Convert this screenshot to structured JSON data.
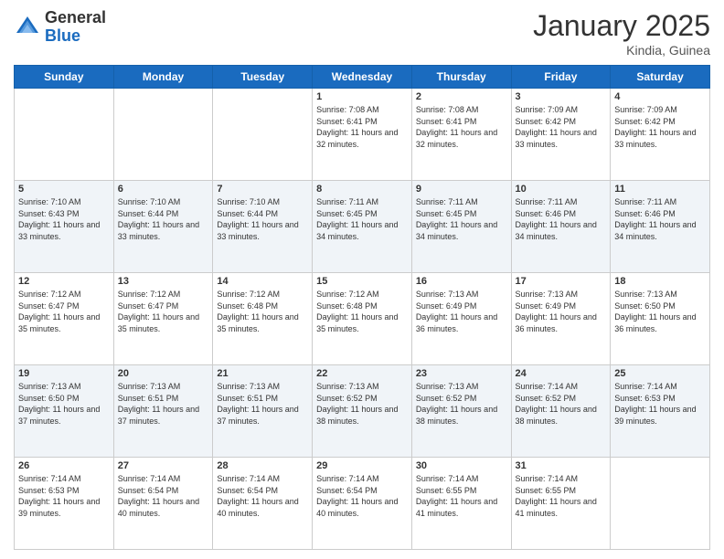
{
  "logo": {
    "general": "General",
    "blue": "Blue"
  },
  "header": {
    "month_year": "January 2025",
    "location": "Kindia, Guinea"
  },
  "weekdays": [
    "Sunday",
    "Monday",
    "Tuesday",
    "Wednesday",
    "Thursday",
    "Friday",
    "Saturday"
  ],
  "weeks": [
    [
      {
        "day": "",
        "sunrise": "",
        "sunset": "",
        "daylight": ""
      },
      {
        "day": "",
        "sunrise": "",
        "sunset": "",
        "daylight": ""
      },
      {
        "day": "",
        "sunrise": "",
        "sunset": "",
        "daylight": ""
      },
      {
        "day": "1",
        "sunrise": "Sunrise: 7:08 AM",
        "sunset": "Sunset: 6:41 PM",
        "daylight": "Daylight: 11 hours and 32 minutes."
      },
      {
        "day": "2",
        "sunrise": "Sunrise: 7:08 AM",
        "sunset": "Sunset: 6:41 PM",
        "daylight": "Daylight: 11 hours and 32 minutes."
      },
      {
        "day": "3",
        "sunrise": "Sunrise: 7:09 AM",
        "sunset": "Sunset: 6:42 PM",
        "daylight": "Daylight: 11 hours and 33 minutes."
      },
      {
        "day": "4",
        "sunrise": "Sunrise: 7:09 AM",
        "sunset": "Sunset: 6:42 PM",
        "daylight": "Daylight: 11 hours and 33 minutes."
      }
    ],
    [
      {
        "day": "5",
        "sunrise": "Sunrise: 7:10 AM",
        "sunset": "Sunset: 6:43 PM",
        "daylight": "Daylight: 11 hours and 33 minutes."
      },
      {
        "day": "6",
        "sunrise": "Sunrise: 7:10 AM",
        "sunset": "Sunset: 6:44 PM",
        "daylight": "Daylight: 11 hours and 33 minutes."
      },
      {
        "day": "7",
        "sunrise": "Sunrise: 7:10 AM",
        "sunset": "Sunset: 6:44 PM",
        "daylight": "Daylight: 11 hours and 33 minutes."
      },
      {
        "day": "8",
        "sunrise": "Sunrise: 7:11 AM",
        "sunset": "Sunset: 6:45 PM",
        "daylight": "Daylight: 11 hours and 34 minutes."
      },
      {
        "day": "9",
        "sunrise": "Sunrise: 7:11 AM",
        "sunset": "Sunset: 6:45 PM",
        "daylight": "Daylight: 11 hours and 34 minutes."
      },
      {
        "day": "10",
        "sunrise": "Sunrise: 7:11 AM",
        "sunset": "Sunset: 6:46 PM",
        "daylight": "Daylight: 11 hours and 34 minutes."
      },
      {
        "day": "11",
        "sunrise": "Sunrise: 7:11 AM",
        "sunset": "Sunset: 6:46 PM",
        "daylight": "Daylight: 11 hours and 34 minutes."
      }
    ],
    [
      {
        "day": "12",
        "sunrise": "Sunrise: 7:12 AM",
        "sunset": "Sunset: 6:47 PM",
        "daylight": "Daylight: 11 hours and 35 minutes."
      },
      {
        "day": "13",
        "sunrise": "Sunrise: 7:12 AM",
        "sunset": "Sunset: 6:47 PM",
        "daylight": "Daylight: 11 hours and 35 minutes."
      },
      {
        "day": "14",
        "sunrise": "Sunrise: 7:12 AM",
        "sunset": "Sunset: 6:48 PM",
        "daylight": "Daylight: 11 hours and 35 minutes."
      },
      {
        "day": "15",
        "sunrise": "Sunrise: 7:12 AM",
        "sunset": "Sunset: 6:48 PM",
        "daylight": "Daylight: 11 hours and 35 minutes."
      },
      {
        "day": "16",
        "sunrise": "Sunrise: 7:13 AM",
        "sunset": "Sunset: 6:49 PM",
        "daylight": "Daylight: 11 hours and 36 minutes."
      },
      {
        "day": "17",
        "sunrise": "Sunrise: 7:13 AM",
        "sunset": "Sunset: 6:49 PM",
        "daylight": "Daylight: 11 hours and 36 minutes."
      },
      {
        "day": "18",
        "sunrise": "Sunrise: 7:13 AM",
        "sunset": "Sunset: 6:50 PM",
        "daylight": "Daylight: 11 hours and 36 minutes."
      }
    ],
    [
      {
        "day": "19",
        "sunrise": "Sunrise: 7:13 AM",
        "sunset": "Sunset: 6:50 PM",
        "daylight": "Daylight: 11 hours and 37 minutes."
      },
      {
        "day": "20",
        "sunrise": "Sunrise: 7:13 AM",
        "sunset": "Sunset: 6:51 PM",
        "daylight": "Daylight: 11 hours and 37 minutes."
      },
      {
        "day": "21",
        "sunrise": "Sunrise: 7:13 AM",
        "sunset": "Sunset: 6:51 PM",
        "daylight": "Daylight: 11 hours and 37 minutes."
      },
      {
        "day": "22",
        "sunrise": "Sunrise: 7:13 AM",
        "sunset": "Sunset: 6:52 PM",
        "daylight": "Daylight: 11 hours and 38 minutes."
      },
      {
        "day": "23",
        "sunrise": "Sunrise: 7:13 AM",
        "sunset": "Sunset: 6:52 PM",
        "daylight": "Daylight: 11 hours and 38 minutes."
      },
      {
        "day": "24",
        "sunrise": "Sunrise: 7:14 AM",
        "sunset": "Sunset: 6:52 PM",
        "daylight": "Daylight: 11 hours and 38 minutes."
      },
      {
        "day": "25",
        "sunrise": "Sunrise: 7:14 AM",
        "sunset": "Sunset: 6:53 PM",
        "daylight": "Daylight: 11 hours and 39 minutes."
      }
    ],
    [
      {
        "day": "26",
        "sunrise": "Sunrise: 7:14 AM",
        "sunset": "Sunset: 6:53 PM",
        "daylight": "Daylight: 11 hours and 39 minutes."
      },
      {
        "day": "27",
        "sunrise": "Sunrise: 7:14 AM",
        "sunset": "Sunset: 6:54 PM",
        "daylight": "Daylight: 11 hours and 40 minutes."
      },
      {
        "day": "28",
        "sunrise": "Sunrise: 7:14 AM",
        "sunset": "Sunset: 6:54 PM",
        "daylight": "Daylight: 11 hours and 40 minutes."
      },
      {
        "day": "29",
        "sunrise": "Sunrise: 7:14 AM",
        "sunset": "Sunset: 6:54 PM",
        "daylight": "Daylight: 11 hours and 40 minutes."
      },
      {
        "day": "30",
        "sunrise": "Sunrise: 7:14 AM",
        "sunset": "Sunset: 6:55 PM",
        "daylight": "Daylight: 11 hours and 41 minutes."
      },
      {
        "day": "31",
        "sunrise": "Sunrise: 7:14 AM",
        "sunset": "Sunset: 6:55 PM",
        "daylight": "Daylight: 11 hours and 41 minutes."
      },
      {
        "day": "",
        "sunrise": "",
        "sunset": "",
        "daylight": ""
      }
    ]
  ]
}
